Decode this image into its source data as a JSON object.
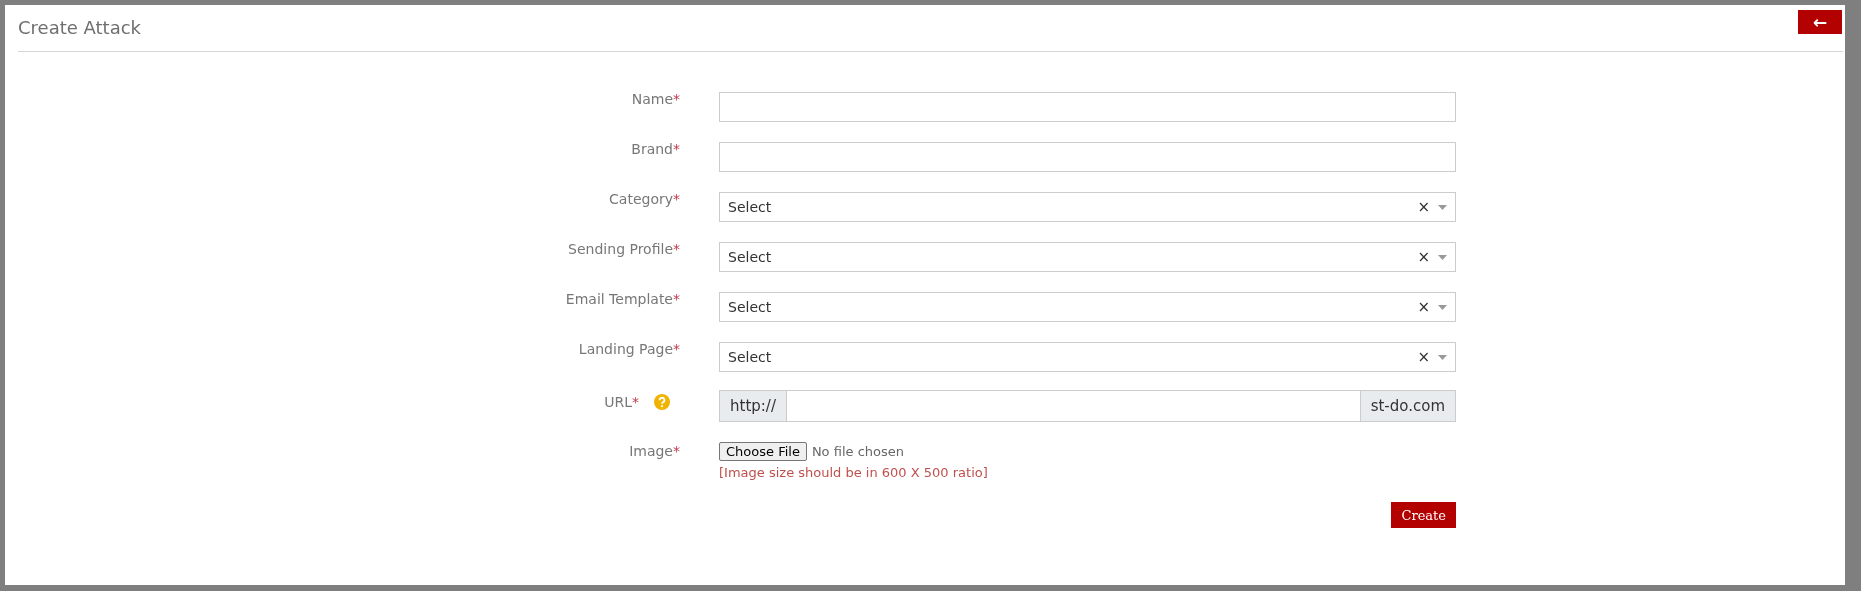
{
  "header": {
    "title": "Create Attack",
    "back_button": "←"
  },
  "fields": [
    {
      "kind": "text",
      "label": "Name",
      "required_mark": "*"
    },
    {
      "kind": "text",
      "label": "Brand",
      "required_mark": "*"
    },
    {
      "kind": "select",
      "label": "Category",
      "required_mark": "*",
      "value": "Select",
      "clear": "×"
    },
    {
      "kind": "select",
      "label": "Sending Profile",
      "required_mark": "*",
      "value": "Select",
      "clear": "×"
    },
    {
      "kind": "select",
      "label": "Email Template",
      "required_mark": "*",
      "value": "Select",
      "clear": "×"
    },
    {
      "kind": "select",
      "label": "Landing Page",
      "required_mark": "*",
      "value": "Select",
      "clear": "×"
    },
    {
      "kind": "url",
      "label": "URL",
      "required_mark": "*",
      "help": true,
      "prefix": "http://",
      "suffix": "st-do.com"
    },
    {
      "kind": "file",
      "label": "Image",
      "required_mark": "*",
      "button": "Choose File",
      "status": "No file chosen",
      "hint": "[Image size should be in 600 X 500 ratio]"
    }
  ],
  "submit": "Create"
}
